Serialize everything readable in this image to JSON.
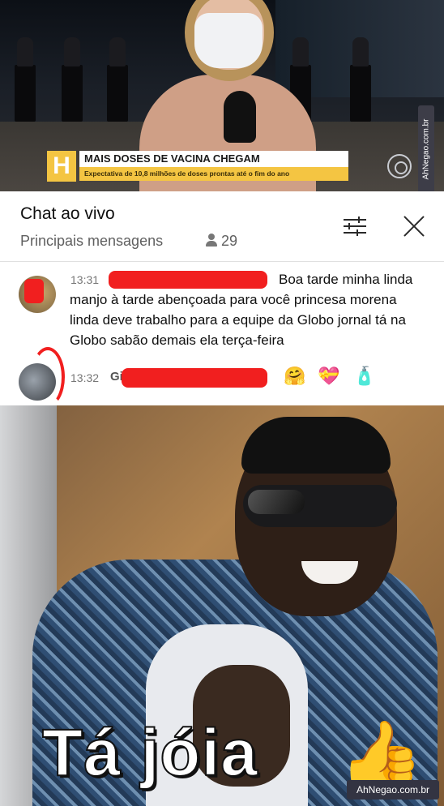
{
  "broadcast": {
    "logo_letter": "H",
    "headline": "MAIS DOSES DE VACINA CHEGAM",
    "subheadline": "Expectativa de 10,8 milhões de doses prontas até o fim do ano",
    "watermark": "AhNegao.com.br"
  },
  "chat": {
    "title": "Chat ao vivo",
    "filter_label": "Principais mensagens",
    "viewer_count": "29",
    "messages": [
      {
        "time": "13:31",
        "text_first": "Boa tarde minha linda",
        "text_rest": "manjo à tarde abençoada para você princesa morena linda deve trabalho para a equipe da Globo jornal tá na Globo sabão demais ela terça-feira"
      },
      {
        "time": "13:32",
        "author_fragment": "Gi",
        "emojis": [
          "🤗",
          "💝",
          "🧴"
        ]
      }
    ]
  },
  "meme": {
    "caption": "Tá jóia",
    "thumb_emoji": "👍",
    "watermark": "AhNegao.com.br"
  },
  "colors": {
    "redaction": "#f11f1f",
    "globo_yellow": "#f4c542"
  }
}
